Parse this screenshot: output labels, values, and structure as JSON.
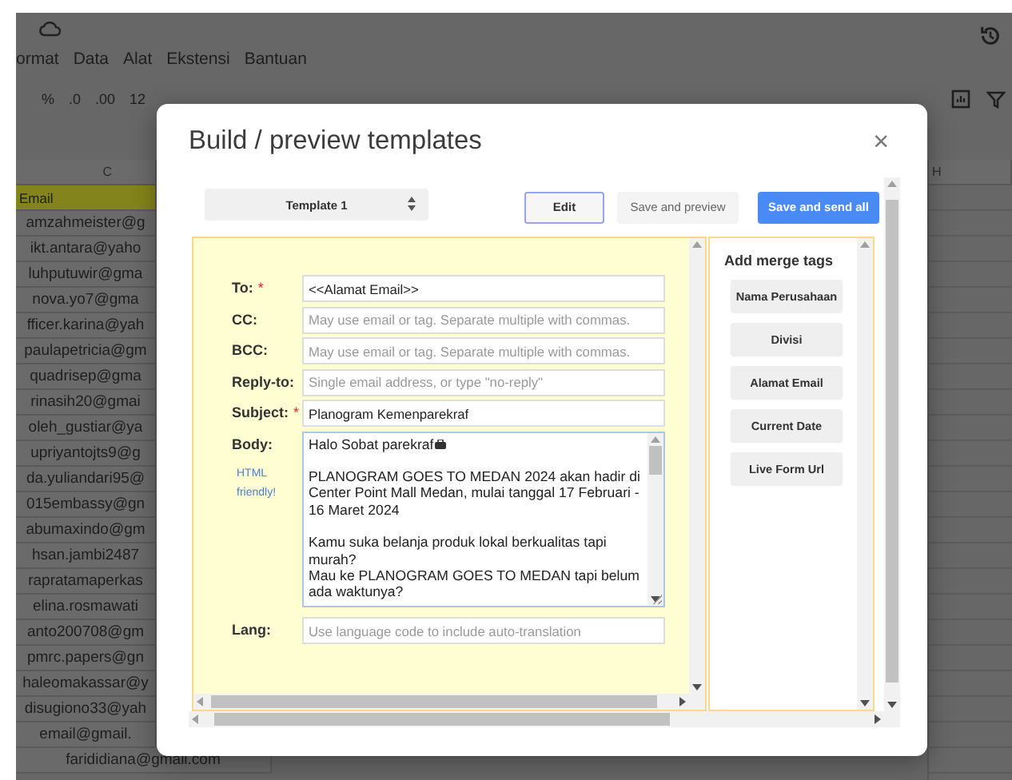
{
  "sheet": {
    "menu": [
      "ormat",
      "Data",
      "Alat",
      "Ekstensi",
      "Bantuan"
    ],
    "toolbar": [
      "%",
      ".0",
      ".00",
      "12"
    ],
    "columns": [
      "C",
      "H"
    ],
    "email_column": {
      "header": "Email",
      "cells": [
        "amzahmeister@g",
        "ikt.antara@yaho",
        "luhputuwir@gma",
        "nova.yo7@gma",
        "fficer.karina@yah",
        "paulapetricia@gm",
        "quadrisep@gma",
        "rinasih20@gmai",
        "oleh_gustiar@ya",
        "upriyantojts9@g",
        "da.yuliandari95@",
        "015embassy@gn",
        "abumaxindo@gm",
        "hsan.jambi2487",
        "rapratamaperkas",
        "elina.rosmawati",
        "anto200708@gm",
        "pmrc.papers@gn",
        "haleomakassar@y",
        "disugiono33@yah"
      ],
      "below_dialog": [
        "email@gmail.",
        "farididiana@gmail.com"
      ]
    }
  },
  "dialog": {
    "title": "Build / preview templates",
    "close": "×",
    "template_select": {
      "value": "Template 1"
    },
    "buttons": [
      {
        "label": "Edit",
        "kind": "outlined"
      },
      {
        "label": "Save and preview",
        "kind": "plain"
      },
      {
        "label": "Save and send all",
        "kind": "primary"
      }
    ],
    "fields": [
      {
        "kind": "text",
        "label": "To:",
        "required_mark": "*",
        "value": "<<Alamat Email>>"
      },
      {
        "kind": "text",
        "label": "CC:",
        "placeholder": "May use email or tag. Separate multiple with commas."
      },
      {
        "kind": "text",
        "label": "BCC:",
        "placeholder": "May use email or tag. Separate multiple with commas."
      },
      {
        "kind": "text",
        "label": "Reply-to:",
        "placeholder": "Single email address, or type \"no-reply\""
      },
      {
        "kind": "text",
        "label": "Subject:",
        "required_mark": "*",
        "value": "Planogram Kemenparekraf"
      },
      {
        "kind": "body",
        "label": "Body:",
        "note": "HTML friendly!",
        "paragraphs": [
          {
            "lines": [
              "Halo Sobat parekraf"
            ]
          },
          {
            "lines": [
              "PLANOGRAM GOES TO MEDAN 2024 akan hadir di Center Point Mall Medan, mulai tanggal 17 Februari - 16 Maret 2024"
            ]
          },
          {
            "lines": [
              "Kamu suka belanja produk lokal berkualitas tapi murah?",
              "Mau ke PLANOGRAM GOES TO MEDAN tapi belum ada waktunya?"
            ]
          }
        ]
      },
      {
        "kind": "text",
        "label": "Lang:",
        "placeholder": "Use language code to include auto-translation"
      }
    ],
    "merge_tags": {
      "title": "Add merge tags",
      "tags": [
        "Nama Perusahaan",
        "Divisi",
        "Alamat Email",
        "Current Date",
        "Live Form Url"
      ]
    }
  }
}
